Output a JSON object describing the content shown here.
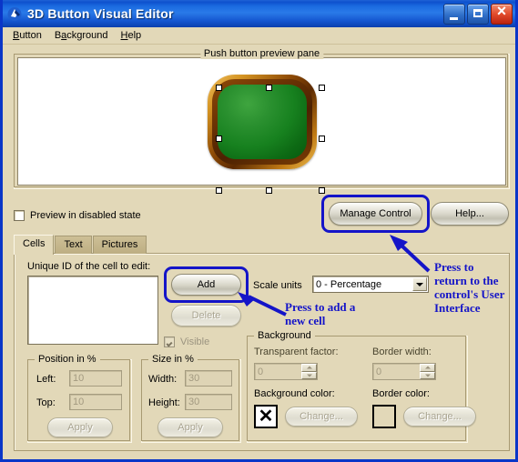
{
  "window": {
    "title": "3D Button Visual Editor",
    "icon": "app-icon",
    "minimize_label": "Minimize",
    "maximize_label": "Maximize",
    "close_label": "Close"
  },
  "menubar": {
    "items": [
      {
        "label": "Button",
        "accel": "B"
      },
      {
        "label": "Background",
        "accel": "a"
      },
      {
        "label": "Help",
        "accel": "H"
      }
    ]
  },
  "preview": {
    "group_title": "Push button preview pane",
    "button": {
      "face_color": "#17811f",
      "bevel_color": "#6d3404",
      "ring_color": "#d49322"
    },
    "handles_count": 8,
    "disabled_checkbox": {
      "label": "Preview in disabled state",
      "checked": false
    }
  },
  "top_buttons": {
    "manage_control": "Manage Control",
    "help": "Help..."
  },
  "tabs": [
    {
      "label": "Cells",
      "active": true
    },
    {
      "label": "Text",
      "active": false
    },
    {
      "label": "Pictures",
      "active": false
    }
  ],
  "cells_tab": {
    "unique_id_label": "Unique ID of the cell to edit:",
    "unique_id_value": "",
    "add_button": "Add",
    "delete_button": "Delete",
    "visible_checkbox": {
      "label": "Visible",
      "checked": true,
      "disabled": true
    },
    "scale_units_label": "Scale units",
    "scale_units_value": "0 - Percentage",
    "position_group": {
      "title": "Position in %",
      "left_label": "Left:",
      "left_value": "10",
      "top_label": "Top:",
      "top_value": "10",
      "apply_label": "Apply"
    },
    "size_group": {
      "title": "Size in %",
      "width_label": "Width:",
      "width_value": "30",
      "height_label": "Height:",
      "height_value": "30",
      "apply_label": "Apply"
    },
    "background_group": {
      "title": "Background",
      "transparent_label": "Transparent factor:",
      "transparent_value": "0",
      "border_width_label": "Border width:",
      "border_width_value": "0",
      "background_color_label": "Background color:",
      "background_color_swatch": "transparent-x",
      "background_change_label": "Change...",
      "border_color_label": "Border color:",
      "border_color_swatch": "#e2d8b8",
      "border_change_label": "Change..."
    }
  },
  "annotations": {
    "accent_color": "#1414c8",
    "add_note": "Press to add a\nnew cell",
    "add_note_line1": "Press to add a",
    "add_note_line2": "new cell",
    "manage_note_line1": "Press to",
    "manage_note_line2": "return to the",
    "manage_note_line3": "control's User",
    "manage_note_line4": "Interface"
  }
}
